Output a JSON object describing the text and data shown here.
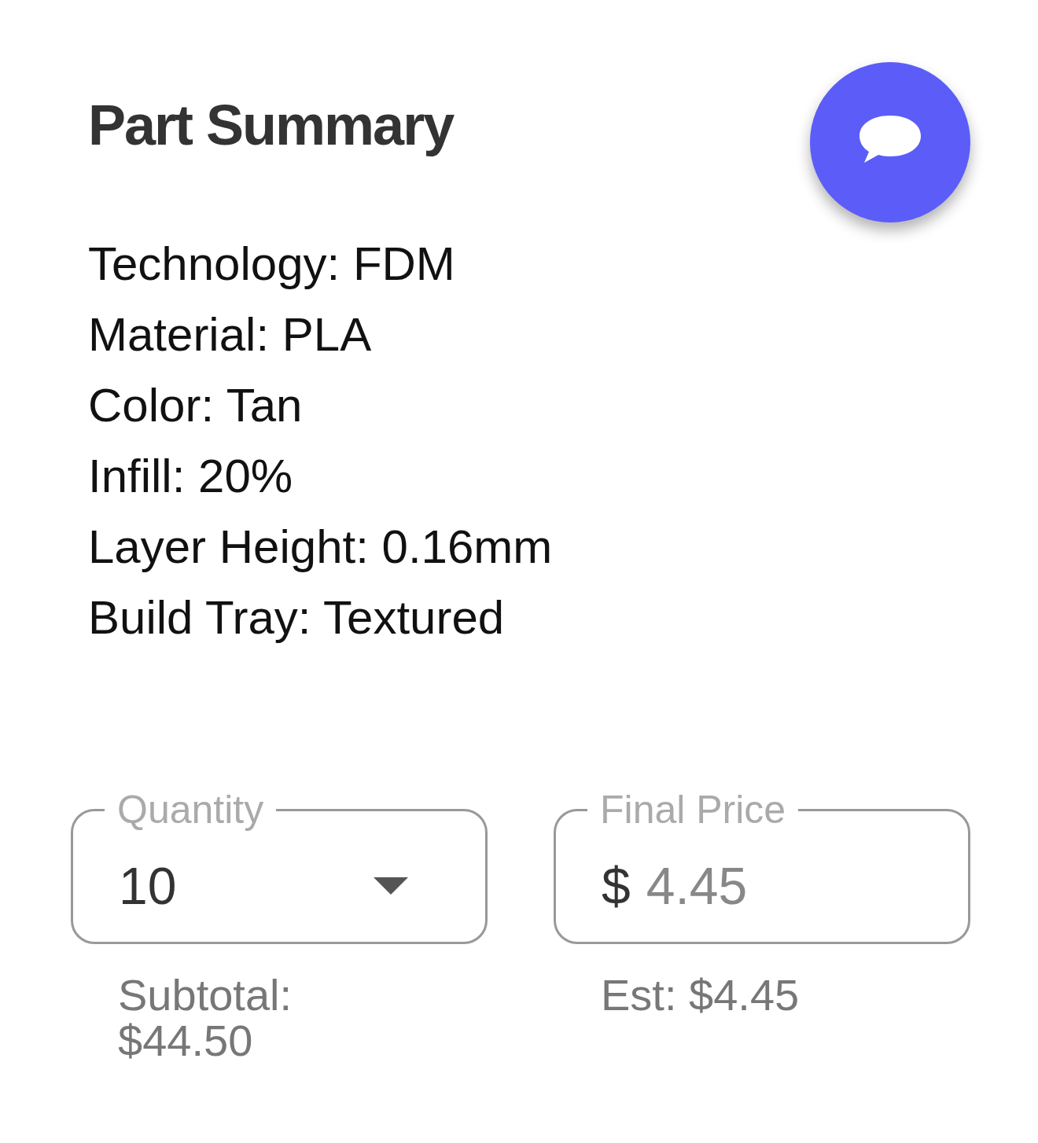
{
  "title": "Part Summary",
  "specs": [
    "Technology: FDM",
    "Material: PLA",
    "Color: Tan",
    "Infill: 20%",
    "Layer Height: 0.16mm",
    "Build Tray: Textured"
  ],
  "fields": [
    {
      "kind": "select",
      "label": "Quantity",
      "value": "10",
      "disabled": false,
      "helper": "Subtotal: $44.50"
    },
    {
      "kind": "currency",
      "label": "Final Price",
      "prefix": "$",
      "value": "4.45",
      "disabled": true,
      "helper": "Est: $4.45"
    }
  ]
}
